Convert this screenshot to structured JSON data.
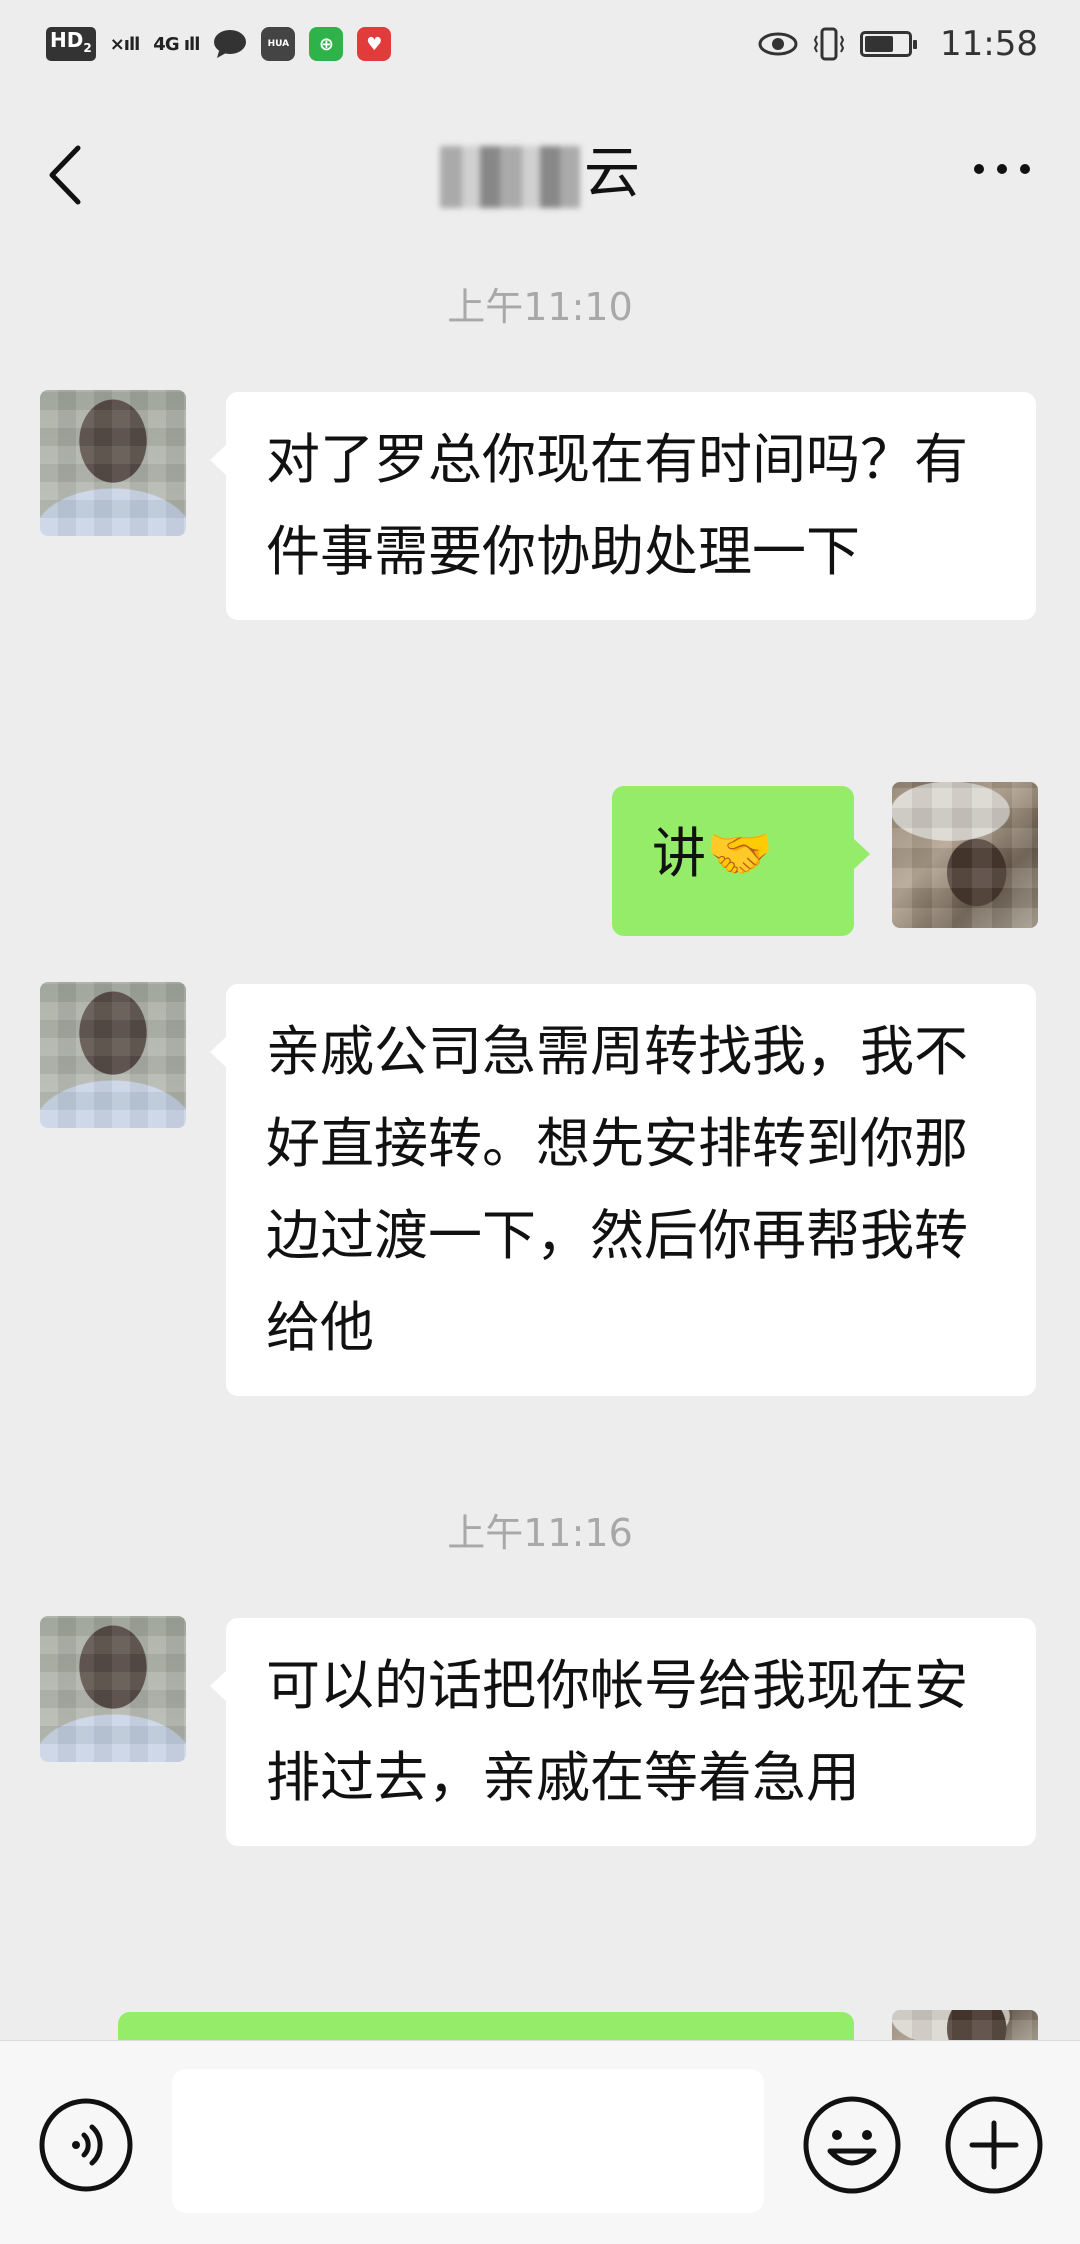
{
  "status_bar": {
    "hd_label": "HD",
    "hd_sim": "2",
    "network_1": "×ıll",
    "network_2": "4G ıll",
    "time": "11:58",
    "icons": [
      "message-icon",
      "huawei-app-icon",
      "green-app-icon",
      "red-app-icon",
      "eye-icon",
      "vibrate-icon",
      "battery-icon"
    ]
  },
  "header": {
    "title_visible": "云",
    "back_icon": "chevron-left-icon",
    "more_icon": "more-dots-icon"
  },
  "messages": [
    {
      "type": "timestamp",
      "text": "上午11:10"
    },
    {
      "type": "incoming",
      "text": "对了罗总你现在有时间吗？有件事需要你协助处理一下"
    },
    {
      "type": "outgoing",
      "text": "讲",
      "emoji": "🤝"
    },
    {
      "type": "incoming",
      "text": "亲戚公司急需周转找我，我不好直接转。想先安排转到你那边过渡一下，然后你再帮我转给他"
    },
    {
      "type": "timestamp",
      "text": "上午11:16"
    },
    {
      "type": "incoming",
      "text": "可以的话把你帐号给我现在安排过去，亲戚在等着急用"
    }
  ],
  "input_bar": {
    "input_value": "",
    "voice_icon": "voice-icon",
    "emoji_icon": "emoji-icon",
    "plus_icon": "plus-icon"
  },
  "colors": {
    "background": "#ededed",
    "incoming_bubble": "#ffffff",
    "outgoing_bubble": "#95ec69",
    "timestamp_text": "#a8a8a8"
  }
}
